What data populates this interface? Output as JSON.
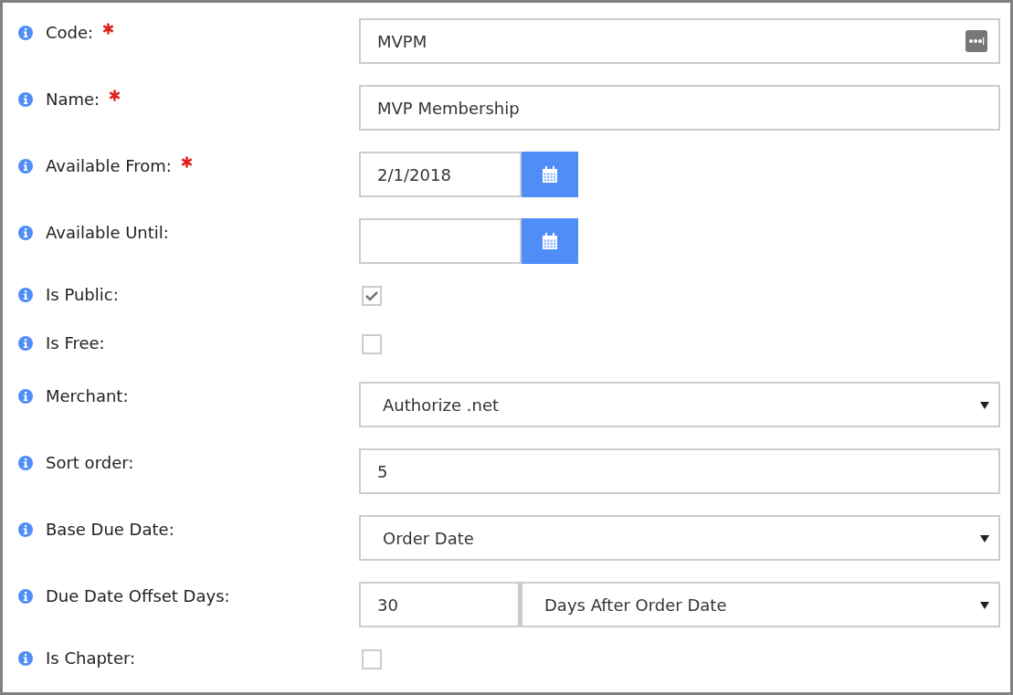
{
  "fields": [
    {
      "kind": "text",
      "label": "Code:",
      "required": true,
      "value": "MVPM",
      "lookup": true
    },
    {
      "kind": "text",
      "label": "Name:",
      "required": true,
      "value": "MVP Membership",
      "lookup": false
    },
    {
      "kind": "date",
      "label": "Available From:",
      "required": true,
      "value": "2/1/2018"
    },
    {
      "kind": "date",
      "label": "Available Until:",
      "required": false
    },
    {
      "kind": "checkbox",
      "label": "Is Public:",
      "required": false,
      "checked": true
    },
    {
      "kind": "checkbox",
      "label": "Is Free:",
      "required": false,
      "checked": false
    },
    {
      "kind": "select",
      "label": "Merchant:",
      "required": false,
      "value": "Authorize .net"
    },
    {
      "kind": "text",
      "label": "Sort order:",
      "required": false,
      "value": "5",
      "lookup": false
    },
    {
      "kind": "select",
      "label": "Base Due Date:",
      "required": false,
      "value": "Order Date"
    },
    {
      "kind": "offset",
      "label": "Due Date Offset Days:",
      "required": false,
      "value": "30",
      "option": "Days After Order Date"
    },
    {
      "kind": "checkbox",
      "label": "Is Chapter:",
      "required": false,
      "checked": false
    }
  ]
}
